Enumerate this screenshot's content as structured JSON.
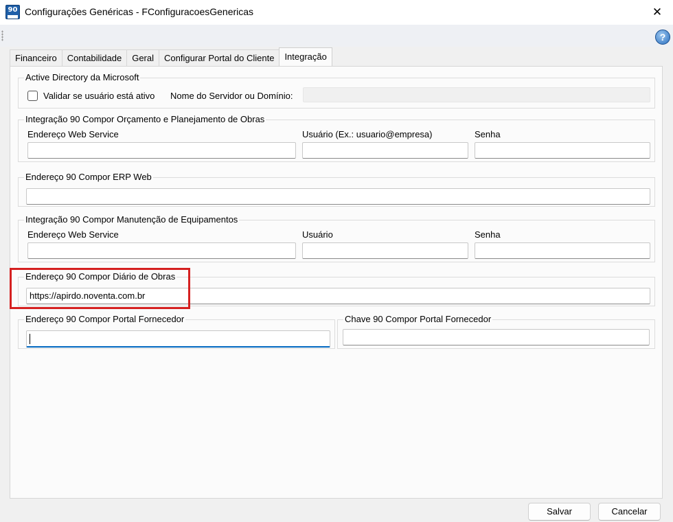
{
  "window": {
    "title": "Configurações Genéricas - FConfiguracoesGenericas",
    "close_glyph": "✕",
    "icon_text": "90"
  },
  "toolbar": {
    "help_glyph": "?"
  },
  "tabs": [
    {
      "label": "Financeiro"
    },
    {
      "label": "Contabilidade"
    },
    {
      "label": "Geral"
    },
    {
      "label": "Configurar Portal do Cliente"
    },
    {
      "label": "Integração",
      "active": true
    }
  ],
  "active_directory": {
    "title": "Active Directory da Microsoft",
    "validate_label": "Validar se usuário está ativo",
    "validate_checked": false,
    "server_label": "Nome do Servidor ou Domínio:",
    "server_value": ""
  },
  "orcamento": {
    "title": "Integração 90 Compor Orçamento e Planejamento de Obras",
    "url_label": "Endereço Web Service",
    "url_value": "",
    "user_label": "Usuário (Ex.: usuario@empresa)",
    "user_value": "",
    "password_label": "Senha",
    "password_value": ""
  },
  "erp_web": {
    "title": "Endereço 90 Compor ERP Web",
    "value": ""
  },
  "manutencao": {
    "title": "Integração 90 Compor Manutenção de Equipamentos",
    "url_label": "Endereço Web Service",
    "url_value": "",
    "user_label": "Usuário",
    "user_value": "",
    "password_label": "Senha",
    "password_value": ""
  },
  "diario_obras": {
    "title": "Endereço 90 Compor Diário de Obras",
    "value": "https://apirdo.noventa.com.br"
  },
  "portal_fornecedor": {
    "title": "Endereço 90 Compor Portal Fornecedor",
    "value": ""
  },
  "chave_fornecedor": {
    "title": "Chave 90 Compor Portal Fornecedor",
    "value": ""
  },
  "buttons": {
    "save": "Salvar",
    "cancel": "Cancelar"
  },
  "colors": {
    "highlight": "#d52020",
    "focus": "#0067c0"
  },
  "icons": [
    "app-logo-icon",
    "close-icon",
    "help-icon",
    "grip-icon",
    "checkbox-icon"
  ]
}
